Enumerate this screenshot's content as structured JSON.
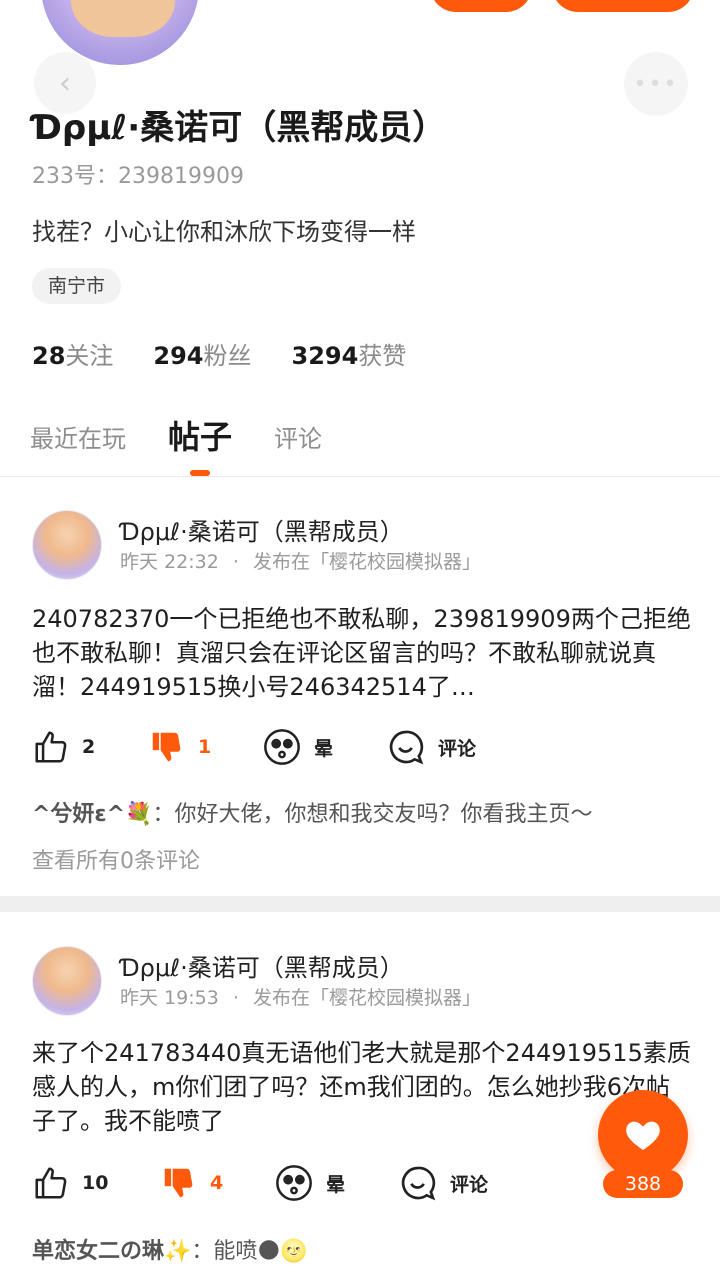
{
  "profile": {
    "name": "Ɗρμℓ·桑诺可（黑帮成员）",
    "uid": "233号：239819909",
    "bio": "找茬？小心让你和沐欣下场变得一样",
    "location": "南宁市",
    "stats": [
      {
        "num": "28",
        "label": "关注"
      },
      {
        "num": "294",
        "label": "粉丝"
      },
      {
        "num": "3294",
        "label": "获赞"
      }
    ]
  },
  "tabs": [
    {
      "label": "最近在玩",
      "active": false
    },
    {
      "label": "帖子",
      "active": true
    },
    {
      "label": "评论",
      "active": false
    }
  ],
  "posts": [
    {
      "author": "Ɗρμℓ·桑诺可（黑帮成员）",
      "time": "昨天 22:32",
      "venue": "发布在「樱花校园模拟器」",
      "body": "240782370一个已拒绝也不敢私聊，239819909两个己拒绝也不敢私聊！真溜只会在评论区留言的吗？不敢私聊就说真溜！244919515换小号246342514了…",
      "likes": "2",
      "dislikes": "1",
      "dizzy_label": "晕",
      "comment_label": "评论",
      "top_comment": {
        "user": "^兮妍ɛ^💐",
        "text": "你好大佬，你想和我交友吗？你看我主页～"
      },
      "view_all": "查看所有0条评论"
    },
    {
      "author": "Ɗρμℓ·桑诺可（黑帮成员）",
      "time": "昨天 19:53",
      "venue": "发布在「樱花校园模拟器」",
      "body": "来了个241783440真无语他们老大就是那个244919515素质感人的人，m你们团了吗？还m我们团的。怎么她抄我6次帖子了。我不能喷了",
      "likes": "10",
      "dislikes": "4",
      "dizzy_label": "晕",
      "comment_label": "评论",
      "top_comment": {
        "user": "单恋女二の琳✨",
        "text": "能喷🌑🌝"
      }
    }
  ],
  "fab": {
    "count": "388"
  },
  "colors": {
    "accent": "#ff5a0c",
    "muted": "#9a9a9a",
    "text": "#1f1f1f"
  },
  "icons": [
    "back-arrow-icon",
    "more-dots-icon",
    "thumb-up-icon",
    "thumb-down-icon",
    "dizzy-face-icon",
    "comment-bubble-icon",
    "heart-icon"
  ]
}
